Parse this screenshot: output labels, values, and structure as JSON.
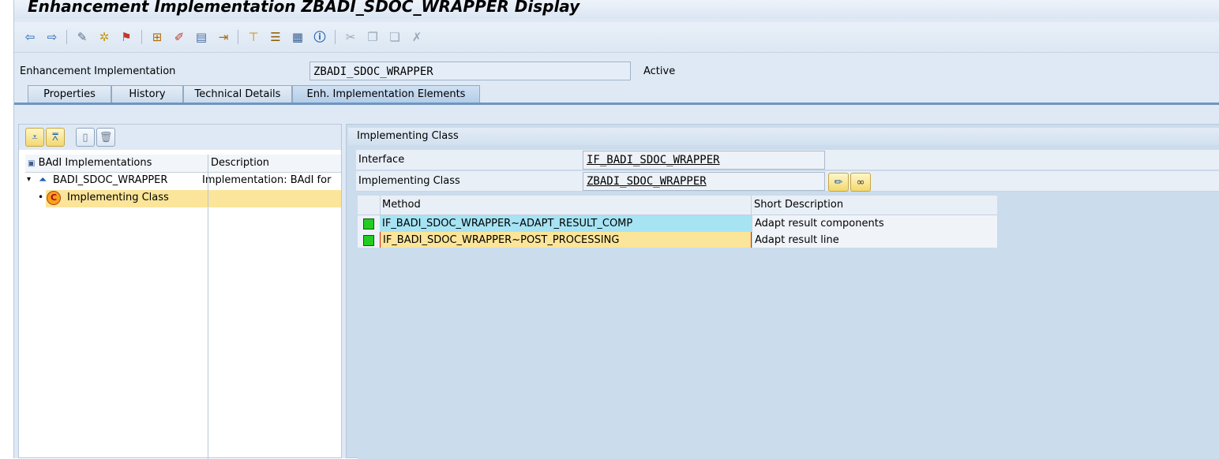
{
  "window": {
    "title": "Enhancement Implementation ZBADI_SDOC_WRAPPER Display"
  },
  "toolbar": {
    "icons": [
      "back-icon",
      "forward-icon",
      "other-object-icon",
      "display-change-icon",
      "activate-icon",
      "where-used-icon",
      "object-list-icon",
      "enhancement-icon",
      "navigate-icon",
      "hierarchy-icon",
      "outline-icon",
      "display-object-list-icon",
      "info-icon",
      "cut-icon",
      "copy-icon",
      "paste-icon",
      "undo-icon"
    ]
  },
  "header": {
    "label": "Enhancement Implementation",
    "value": "ZBADI_SDOC_WRAPPER",
    "status": "Active"
  },
  "tabs": [
    {
      "label": "Properties"
    },
    {
      "label": "History"
    },
    {
      "label": "Technical Details"
    },
    {
      "label": "Enh. Implementation Elements",
      "active": true
    }
  ],
  "tree": {
    "col1": "BAdI Implementations",
    "col2": "Description",
    "rows": [
      {
        "name": "BADI_SDOC_WRAPPER",
        "description": "Implementation: BAdI for"
      },
      {
        "name": "Implementing Class",
        "description": ""
      }
    ]
  },
  "detail": {
    "header": "Implementing Class",
    "interface_label": "Interface",
    "interface_value": "IF_BADI_SDOC_WRAPPER",
    "class_label": "Implementing Class",
    "class_value": "ZBADI_SDOC_WRAPPER"
  },
  "methods": {
    "col_method": "Method",
    "col_desc": "Short Description",
    "rows": [
      {
        "method": "IF_BADI_SDOC_WRAPPER~ADAPT_RESULT_COMP",
        "desc": "Adapt result components"
      },
      {
        "method": "IF_BADI_SDOC_WRAPPER~POST_PROCESSING",
        "desc": "Adapt result line"
      }
    ]
  },
  "colors": {
    "row_selected_cyan": "#a6e3f3",
    "row_selected_yellow": "#fbe59a",
    "status_green": "#22cc22",
    "tab_accent": "#6f95bf"
  }
}
